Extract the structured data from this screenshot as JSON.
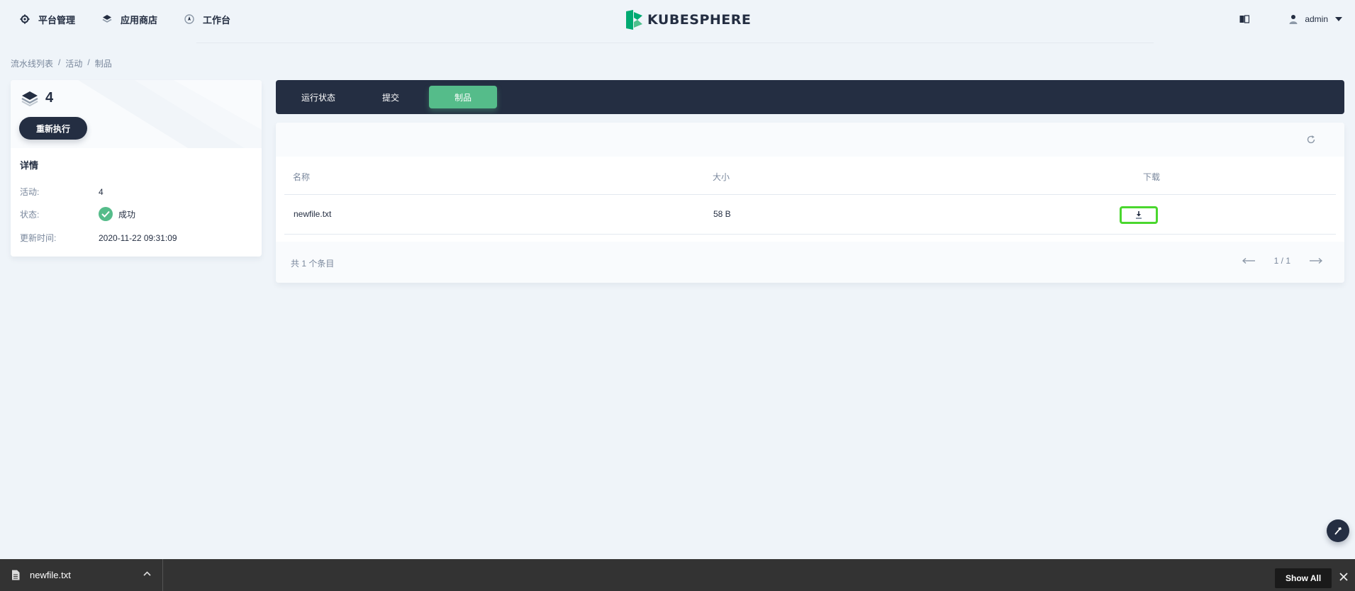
{
  "nav": {
    "items": [
      {
        "label": "平台管理",
        "icon": "gear-icon"
      },
      {
        "label": "应用商店",
        "icon": "stack-icon"
      },
      {
        "label": "工作台",
        "icon": "compass-icon"
      }
    ],
    "logo_text": "KUBESPHERE",
    "user": "admin"
  },
  "breadcrumb": [
    "流水线列表",
    "活动",
    "制品"
  ],
  "run": {
    "number": "4",
    "rerun_label": "重新执行",
    "detail_title": "详情",
    "details": [
      {
        "key": "活动:",
        "value": "4"
      },
      {
        "key": "状态:",
        "value": "成功"
      },
      {
        "key": "更新时间:",
        "value": "2020-11-22 09:31:09"
      }
    ]
  },
  "tabs": [
    {
      "label": "运行状态",
      "active": false
    },
    {
      "label": "提交",
      "active": false
    },
    {
      "label": "制品",
      "active": true
    }
  ],
  "table": {
    "columns": [
      "名称",
      "大小",
      "下载"
    ],
    "rows": [
      {
        "name": "newfile.txt",
        "size": "58 B"
      }
    ],
    "total": "共 1 个条目",
    "page": "1 / 1"
  },
  "download_bar": {
    "filename": "newfile.txt",
    "show_all": "Show All"
  },
  "colors": {
    "accent": "#55bc8a",
    "dark": "#242e42",
    "highlight": "#4ad72e"
  }
}
